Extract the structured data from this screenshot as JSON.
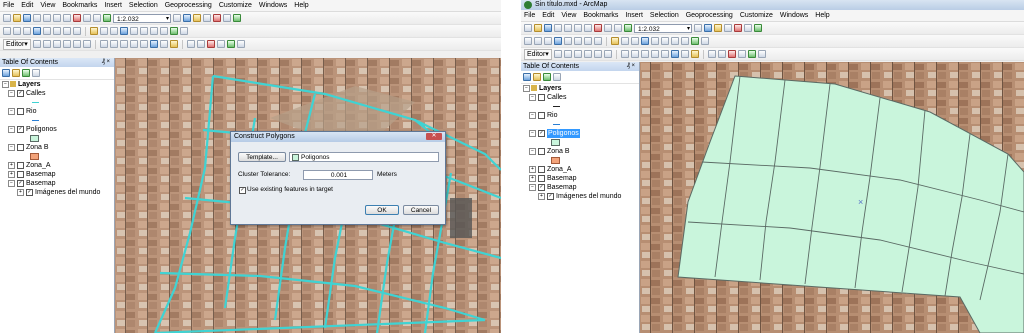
{
  "left": {
    "menu": [
      "File",
      "Edit",
      "View",
      "Bookmarks",
      "Insert",
      "Selection",
      "Geoprocessing",
      "Customize",
      "Windows",
      "Help"
    ],
    "scale": "1:2.032",
    "editor_label": "Editor",
    "toc_title": "Table Of Contents",
    "layers_root": "Layers",
    "layers": [
      {
        "name": "Calles",
        "checked": true
      },
      {
        "name": "Rio",
        "checked": false
      },
      {
        "name": "Poligonos",
        "checked": true
      },
      {
        "name": "Zona B",
        "checked": false
      },
      {
        "name": "Zona_A",
        "checked": false
      },
      {
        "name": "Basemap",
        "checked": false
      },
      {
        "name": "Basemap",
        "checked": true
      },
      {
        "name": "Imágenes del mundo",
        "checked": true
      }
    ],
    "dialog": {
      "title": "Construct Polygons",
      "template_button": "Template...",
      "template_value": "Poligonos",
      "tolerance_label": "Cluster Tolerance:",
      "tolerance_value": "0.001",
      "tolerance_unit": "Meters",
      "use_existing_label": "Use existing features in target",
      "use_existing_checked": true,
      "ok": "OK",
      "cancel": "Cancel"
    }
  },
  "right": {
    "window_title": "Sin título.mxd - ArcMap",
    "menu": [
      "File",
      "Edit",
      "View",
      "Bookmarks",
      "Insert",
      "Selection",
      "Geoprocessing",
      "Customize",
      "Windows",
      "Help"
    ],
    "scale": "1:2.032",
    "editor_label": "Editor",
    "toc_title": "Table Of Contents",
    "layers_root": "Layers",
    "layers": [
      {
        "name": "Calles",
        "checked": false
      },
      {
        "name": "Rio",
        "checked": false
      },
      {
        "name": "Poligonos",
        "checked": true,
        "selected": true
      },
      {
        "name": "Zona B",
        "checked": false
      },
      {
        "name": "Zona_A",
        "checked": false
      },
      {
        "name": "Basemap",
        "checked": false
      },
      {
        "name": "Basemap",
        "checked": true
      },
      {
        "name": "Imágenes del mundo",
        "checked": true
      }
    ]
  },
  "colors": {
    "street_lines": "#3fd3d3",
    "polygon_fill": "#c9f5dc",
    "polygon_outline": "#5a6a64",
    "rio_symbol": "#2a7fd4",
    "zona_b_symbol": "#f3a37a"
  },
  "icons": {
    "map_marker": "x-icon",
    "expand": "plus-minus-icon"
  }
}
